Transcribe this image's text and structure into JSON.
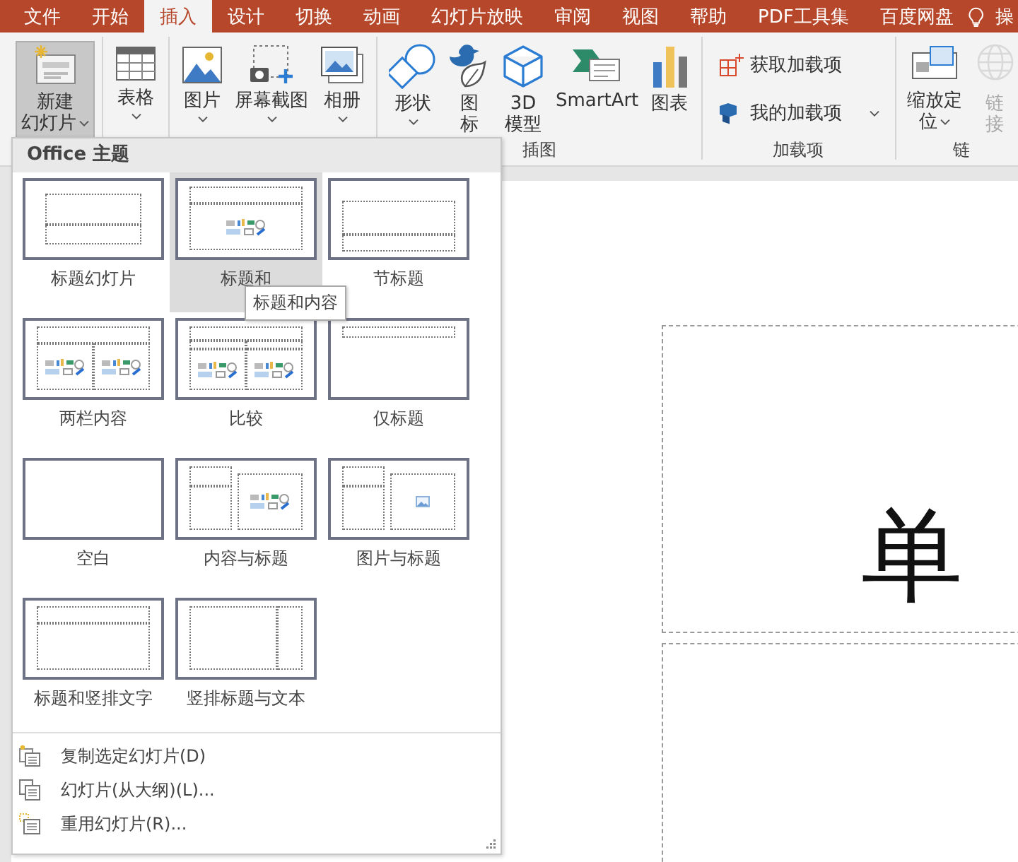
{
  "tabs": [
    {
      "label": "文件",
      "selected": false
    },
    {
      "label": "开始",
      "selected": false
    },
    {
      "label": "插入",
      "selected": true
    },
    {
      "label": "设计",
      "selected": false
    },
    {
      "label": "切换",
      "selected": false
    },
    {
      "label": "动画",
      "selected": false
    },
    {
      "label": "幻灯片放映",
      "selected": false
    },
    {
      "label": "审阅",
      "selected": false
    },
    {
      "label": "视图",
      "selected": false
    },
    {
      "label": "帮助",
      "selected": false
    },
    {
      "label": "PDF工具集",
      "selected": false
    },
    {
      "label": "百度网盘",
      "selected": false
    }
  ],
  "tell_me": {
    "label": "操"
  },
  "ribbon_groups": [
    {
      "items": [
        {
          "kind": "large",
          "lines": [
            "新建",
            "幻灯片"
          ],
          "dropdown": true,
          "pressed": true,
          "disabled": false
        }
      ]
    },
    {
      "items": [
        {
          "kind": "large",
          "lines": [
            "表格"
          ],
          "dropdown": true,
          "pressed": false,
          "disabled": false
        }
      ]
    },
    {
      "items": [
        {
          "kind": "large",
          "lines": [
            "图片"
          ],
          "dropdown": true,
          "pressed": false,
          "disabled": false
        },
        {
          "kind": "large",
          "lines": [
            "屏幕截图"
          ],
          "dropdown": true,
          "pressed": false,
          "disabled": false
        },
        {
          "kind": "large",
          "lines": [
            "相册"
          ],
          "dropdown": true,
          "pressed": false,
          "disabled": false
        }
      ]
    },
    {
      "label": "插图",
      "items": [
        {
          "kind": "large",
          "lines": [
            "形状"
          ],
          "dropdown": true,
          "pressed": false,
          "disabled": false
        },
        {
          "kind": "large",
          "lines": [
            "图",
            "标"
          ],
          "dropdown": false,
          "pressed": false,
          "disabled": false
        },
        {
          "kind": "large",
          "lines": [
            "3D",
            "模型"
          ],
          "dropdown": false,
          "pressed": false,
          "disabled": false
        },
        {
          "kind": "large",
          "lines": [
            "SmartArt"
          ],
          "dropdown": false,
          "pressed": false,
          "disabled": false
        },
        {
          "kind": "large",
          "lines": [
            "图表"
          ],
          "dropdown": false,
          "pressed": false,
          "disabled": false
        }
      ]
    },
    {
      "label": "加载项",
      "items": [
        {
          "kind": "small",
          "lines": [
            "获取加载项"
          ],
          "dropdown": false,
          "pressed": false,
          "disabled": false
        },
        {
          "kind": "small",
          "lines": [
            "我的加载项"
          ],
          "dropdown": true,
          "pressed": false,
          "disabled": false
        }
      ]
    },
    {
      "label": "链",
      "items": [
        {
          "kind": "large",
          "lines": [
            "缩放定",
            "位"
          ],
          "dropdown": true,
          "pressed": false,
          "disabled": false
        },
        {
          "kind": "large",
          "lines": [
            "链",
            "接"
          ],
          "dropdown": false,
          "pressed": false,
          "disabled": true
        }
      ]
    }
  ],
  "new_slide_menu": {
    "title": "Office 主题",
    "layouts": [
      {
        "kind": "title",
        "label": "标题幻灯片",
        "selected": false
      },
      {
        "kind": "title_content",
        "label": "标题和",
        "selected": true
      },
      {
        "kind": "section",
        "label": "节标题",
        "selected": false
      },
      {
        "kind": "two_content",
        "label": "两栏内容",
        "selected": false
      },
      {
        "kind": "comparison",
        "label": "比较",
        "selected": false
      },
      {
        "kind": "title_only",
        "label": "仅标题",
        "selected": false
      },
      {
        "kind": "blank",
        "label": "空白",
        "selected": false
      },
      {
        "kind": "content_caption",
        "label": "内容与标题",
        "selected": false
      },
      {
        "kind": "picture_caption",
        "label": "图片与标题",
        "selected": false
      },
      {
        "kind": "vertical_text",
        "label": "标题和竖排文字",
        "selected": false
      },
      {
        "kind": "vertical_title",
        "label": "竖排标题与文本",
        "selected": false
      }
    ],
    "tooltip": "标题和内容",
    "commands": [
      {
        "label": "复制选定幻灯片(D)"
      },
      {
        "label": "幻灯片(从大纲)(L)..."
      },
      {
        "label": "重用幻灯片(R)..."
      }
    ]
  },
  "slide": {
    "title_placeholder": "单"
  }
}
